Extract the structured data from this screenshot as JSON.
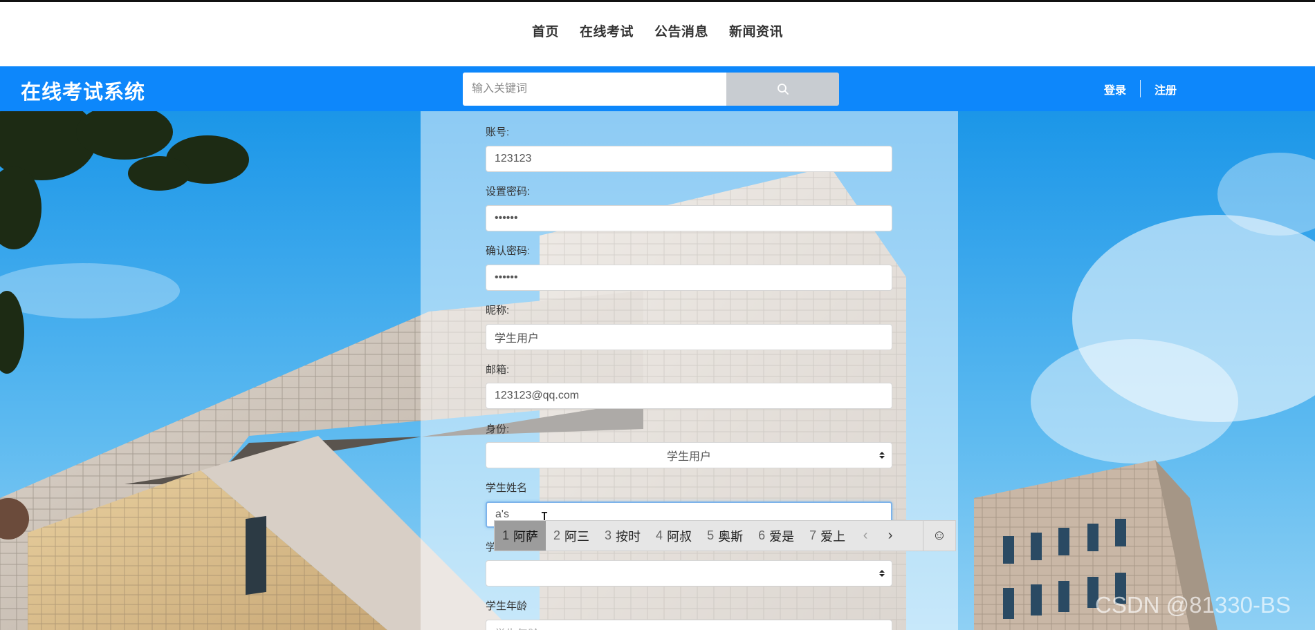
{
  "nav": {
    "items": [
      "首页",
      "在线考试",
      "公告消息",
      "新闻资讯"
    ]
  },
  "header": {
    "brand": "在线考试系统",
    "search_placeholder": "输入关键词",
    "login": "登录",
    "register": "注册"
  },
  "form": {
    "account": {
      "label": "账号:",
      "value": "123123"
    },
    "password": {
      "label": "设置密码:",
      "value": "••••••"
    },
    "confirm": {
      "label": "确认密码:",
      "value": "••••••"
    },
    "nickname": {
      "label": "昵称:",
      "value": "学生用户"
    },
    "email": {
      "label": "邮箱:",
      "value": "123123@qq.com"
    },
    "role": {
      "label": "身份:",
      "value": "学生用户"
    },
    "student_name": {
      "label": "学生姓名",
      "value": "a's"
    },
    "student_gender": {
      "label": "学",
      "value": ""
    },
    "student_age": {
      "label": "学生年龄",
      "placeholder": "学生年龄"
    }
  },
  "ime": {
    "candidates": [
      {
        "num": "1",
        "text": "阿萨"
      },
      {
        "num": "2",
        "text": "阿三"
      },
      {
        "num": "3",
        "text": "按时"
      },
      {
        "num": "4",
        "text": "阿叔"
      },
      {
        "num": "5",
        "text": "奥斯"
      },
      {
        "num": "6",
        "text": "爱是"
      },
      {
        "num": "7",
        "text": "爱上"
      }
    ],
    "prev": "‹",
    "next": "›",
    "emoji": "☺"
  },
  "watermark": "CSDN @81330-BS",
  "colors": {
    "header_blue": "#0d87fb",
    "sky": "#3aa7ee"
  }
}
